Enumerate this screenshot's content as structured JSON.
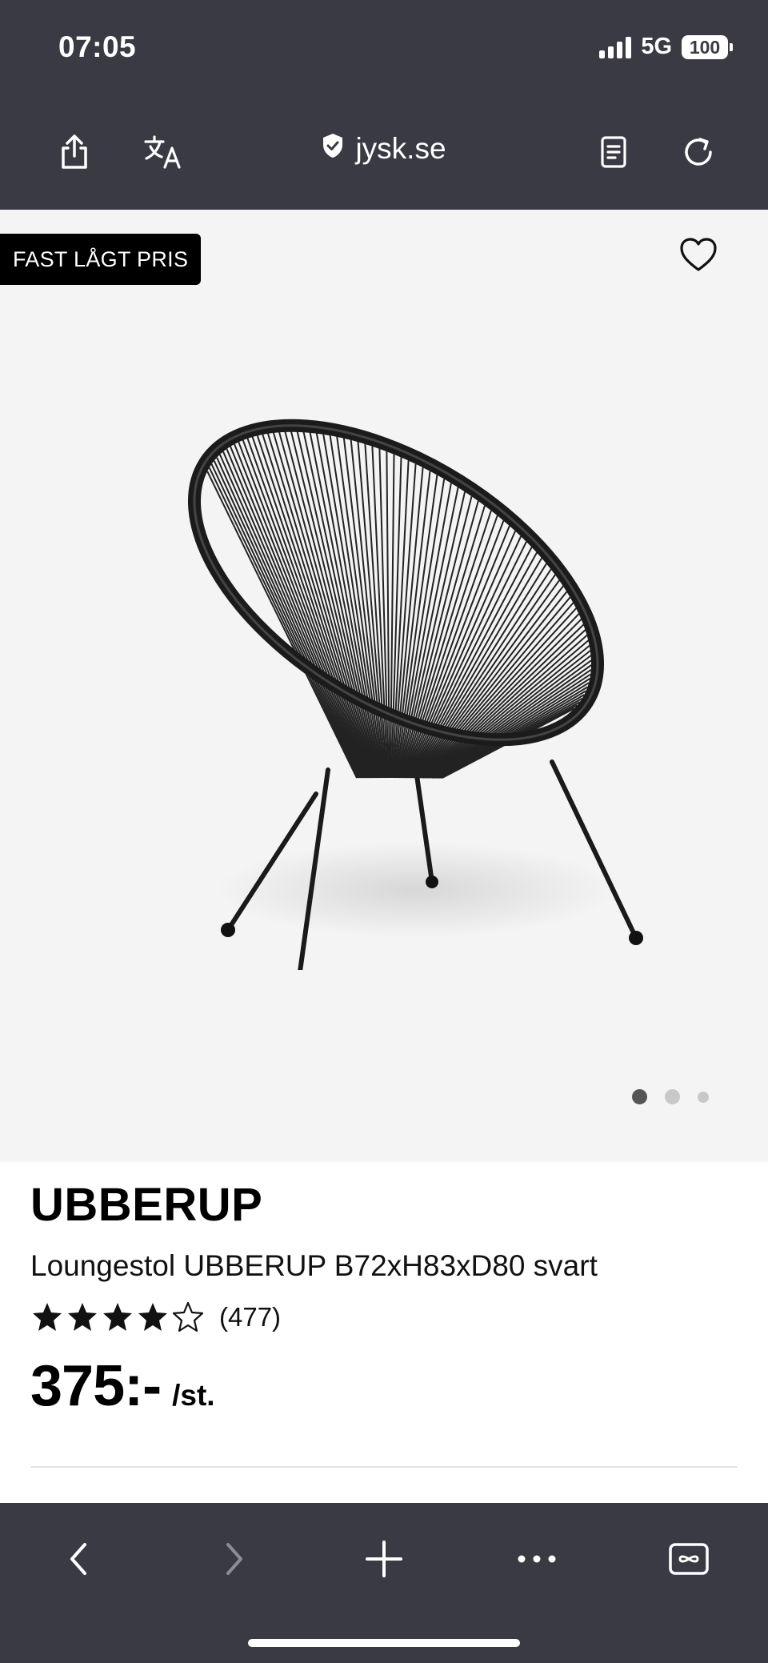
{
  "status_bar": {
    "time": "07:05",
    "network": "5G",
    "battery": "100"
  },
  "browser": {
    "url": "jysk.se",
    "icons": [
      "share-icon",
      "translate-icon",
      "shield-icon",
      "reader-icon",
      "reload-icon"
    ]
  },
  "product": {
    "badge": "FAST LÅGT PRIS",
    "name": "UBBERUP",
    "description": "Loungestol UBBERUP B72xH83xD80 svart",
    "rating_value": 4.5,
    "rating_max": 5,
    "rating_count": "(477)",
    "price": "375:-",
    "price_unit": "/st.",
    "image_count": 3,
    "active_image": 1
  },
  "toolbar": {
    "icons": [
      "back-icon",
      "forward-icon",
      "new-tab-icon",
      "more-icon",
      "tabs-icon"
    ]
  },
  "colors": {
    "chrome": "#3a3a44",
    "hero_bg": "#f4f4f4",
    "badge_bg": "#000000",
    "text": "#000000"
  }
}
